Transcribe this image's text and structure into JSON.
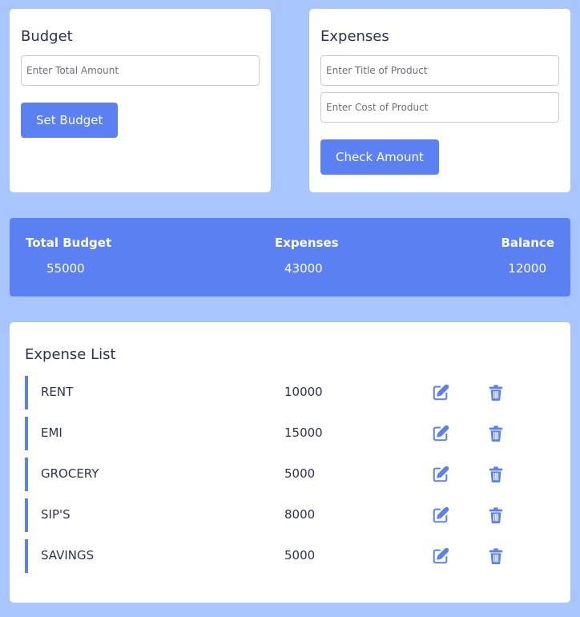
{
  "budget": {
    "title": "Budget",
    "input_placeholder": "Enter Total Amount",
    "button_label": "Set Budget"
  },
  "expenses": {
    "title": "Expenses",
    "title_placeholder": "Enter Title of Product",
    "cost_placeholder": "Enter Cost of Product",
    "button_label": "Check Amount"
  },
  "summary": {
    "total_label": "Total Budget",
    "total_value": "55000",
    "expenses_label": "Expenses",
    "expenses_value": "43000",
    "balance_label": "Balance",
    "balance_value": "12000"
  },
  "expense_list": {
    "title": "Expense List",
    "items": [
      {
        "title": "RENT",
        "amount": "10000"
      },
      {
        "title": "EMI",
        "amount": "15000"
      },
      {
        "title": "GROCERY",
        "amount": "5000"
      },
      {
        "title": "SIP'S",
        "amount": "8000"
      },
      {
        "title": "SAVINGS",
        "amount": "5000"
      }
    ]
  },
  "icons": {
    "edit": "edit-icon",
    "delete": "trash-icon"
  },
  "colors": {
    "accent": "#5a80f2",
    "background": "#a9c5fd",
    "text": "#2c3350"
  }
}
